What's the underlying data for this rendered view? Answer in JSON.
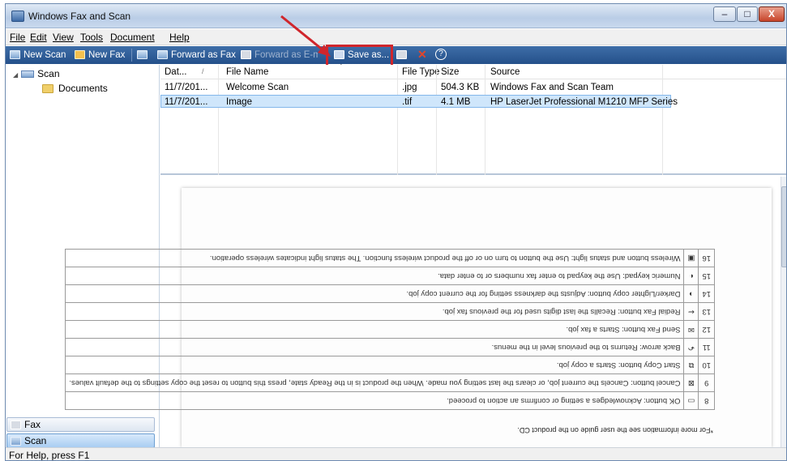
{
  "window": {
    "title": "Windows Fax and Scan",
    "controls": {
      "minimize": "–",
      "maximize": "□",
      "close": "X"
    }
  },
  "menu": [
    "File",
    "Edit",
    "View",
    "Tools",
    "Document",
    "Help"
  ],
  "toolbar": {
    "new_scan": "New Scan",
    "new_fax": "New Fax",
    "forward_fax": "Forward as Fax",
    "forward_email": "Forward as E-mail",
    "save_as": "Save as...",
    "help_glyph": "?"
  },
  "sidebar": {
    "tree": {
      "root": "Scan",
      "child": "Documents"
    },
    "nav": {
      "fax": "Fax",
      "scan": "Scan"
    }
  },
  "filelist": {
    "columns": [
      "Dat...",
      "File Name",
      "File Type",
      "Size",
      "Source"
    ],
    "rows": [
      {
        "date": "11/7/201...",
        "name": "Welcome Scan",
        "type": ".jpg",
        "size": "504.3 KB",
        "source": "Windows Fax and Scan Team"
      },
      {
        "date": "11/7/201...",
        "name": "Image",
        "type": ".tif",
        "size": "4.1 MB",
        "source": "HP LaserJet Professional M1210 MFP Series"
      }
    ]
  },
  "preview": {
    "footnote": "*For more information see the user guide on the product CD.",
    "rows": [
      {
        "n": "16",
        "text": "Wireless button and status light: Use the button to turn on or off the product wireless function. The status light indicates wireless operation."
      },
      {
        "n": "15",
        "text": "Numeric keypad: Use the keypad to enter fax numbers or to enter data."
      },
      {
        "n": "14",
        "text": "Darker/Lighter copy button: Adjusts the darkness setting for the current copy job."
      },
      {
        "n": "13",
        "text": "Redial Fax button: Recalls the last digits used for the previous fax job."
      },
      {
        "n": "12",
        "text": "Send Fax button: Starts a fax job."
      },
      {
        "n": "11",
        "text": "Back arrow: Returns to the previous level in the menus."
      },
      {
        "n": "10",
        "text": "Start Copy button: Starts a copy job."
      },
      {
        "n": "9",
        "text": "Cancel button: Cancels the current job, or clears the last setting you made. When the product is in the Ready state, press this button to reset the copy settings to the default values."
      },
      {
        "n": "8",
        "text": "OK button: Acknowledges a setting or confirms an action to proceed."
      }
    ]
  },
  "status": {
    "text": "For Help, press F1"
  },
  "colors": {
    "toolbar": "#2e5c98",
    "highlight": "#d0262c",
    "selection": "#cfe6fb"
  }
}
